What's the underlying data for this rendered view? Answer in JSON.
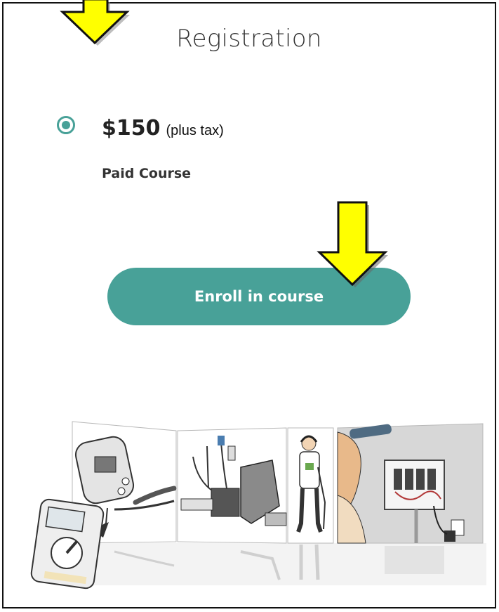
{
  "page": {
    "title": "Registration"
  },
  "option": {
    "price": "$150",
    "price_note": "(plus tax)",
    "course_type": "Paid Course",
    "selected": true
  },
  "actions": {
    "enroll_label": "Enroll in course"
  },
  "icons": {
    "pointer_arrow": "down-arrow-icon",
    "selected_radio": "radio-selected-icon"
  },
  "colors": {
    "accent": "#48a198",
    "arrow_fill": "#ffff00",
    "title_text": "#333333"
  }
}
